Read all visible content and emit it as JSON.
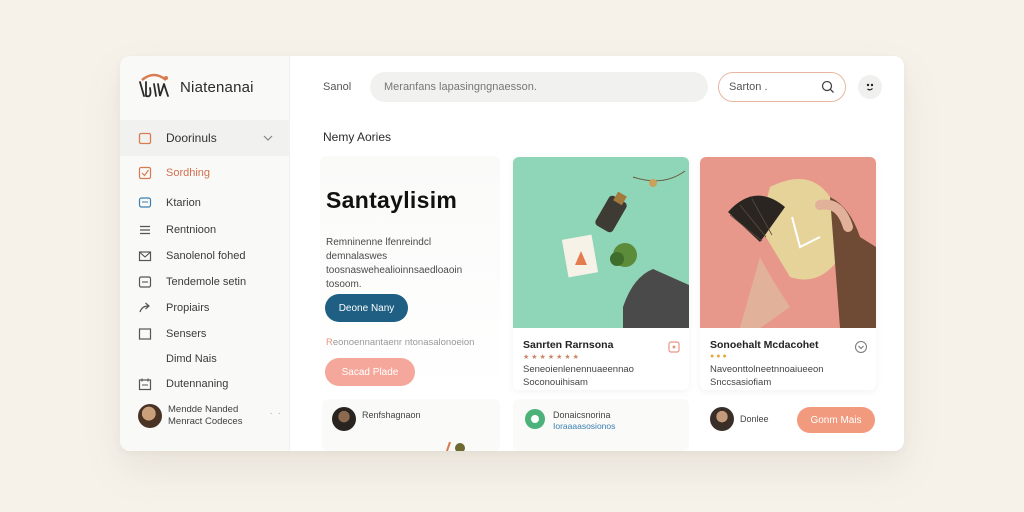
{
  "brand": {
    "name": "Niatenanai"
  },
  "sidebar": {
    "section": {
      "label": "Doorinuls"
    },
    "items": [
      {
        "label": "Sordhing",
        "icon": "check-square-icon",
        "active": true
      },
      {
        "label": "Ktarion",
        "icon": "chat-icon"
      },
      {
        "label": "Rentnioon",
        "icon": "list-icon"
      },
      {
        "label": "Sanolenol fohed",
        "icon": "mail-icon"
      },
      {
        "label": "Tendemole setin",
        "icon": "window-icon"
      },
      {
        "label": "Propiairs",
        "icon": "share-icon"
      },
      {
        "label": "Sensers",
        "icon": "square-icon"
      },
      {
        "label": "Dimd Nais",
        "icon": ""
      },
      {
        "label": "Dutennaning",
        "icon": "calendar-icon"
      }
    ],
    "profile": {
      "line1": "Mendde Nanded",
      "line2": "Menract Codeces"
    }
  },
  "header": {
    "label": "Sanol",
    "search_placeholder": "Meranfans lapasingngnaesson.",
    "search_box_text": "Sarton ."
  },
  "main": {
    "section_title": "Nemy Aories",
    "hero": {
      "title": "Santaylisim",
      "description": "Remninenne lfenreindcl demnalaswes toosnaswehealioinnsaedloaoin tosoom.",
      "primary_button": "Deone Nany",
      "note_mark": "R",
      "note": "eonoennantaenr ntonasalonoeion",
      "secondary_button": "Sacad Plade"
    },
    "cards": [
      {
        "name": "Sanrten Rarnsona",
        "rating": "★★★★★★★",
        "desc_line1": "Seneoienlenennuaeennao",
        "desc_line2": "Soconouihisam",
        "rating_color": "#c9866a",
        "icon": "bookmark-icon"
      },
      {
        "name": "Sonoehalt Mcdacohet",
        "rating": "●●●",
        "desc_line1": "Naveonttolneetnnoaiueeon",
        "desc_line2": "Snccsasiofiam",
        "rating_color": "#e3a93c",
        "icon": "chevron-down-icon"
      }
    ],
    "bottom": [
      {
        "t1": "Renfshagnaon"
      },
      {
        "t1": "Donaicsnorina",
        "t2": "Ioraaaasosionos"
      },
      {
        "t1": "Donlee",
        "button": "Gonm Mais"
      }
    ]
  },
  "colors": {
    "accent": "#1f5f84",
    "peach": "#f4a79a",
    "coral": "#f19a7e",
    "mint": "#8fd6b8",
    "salmon": "#e8988a"
  }
}
